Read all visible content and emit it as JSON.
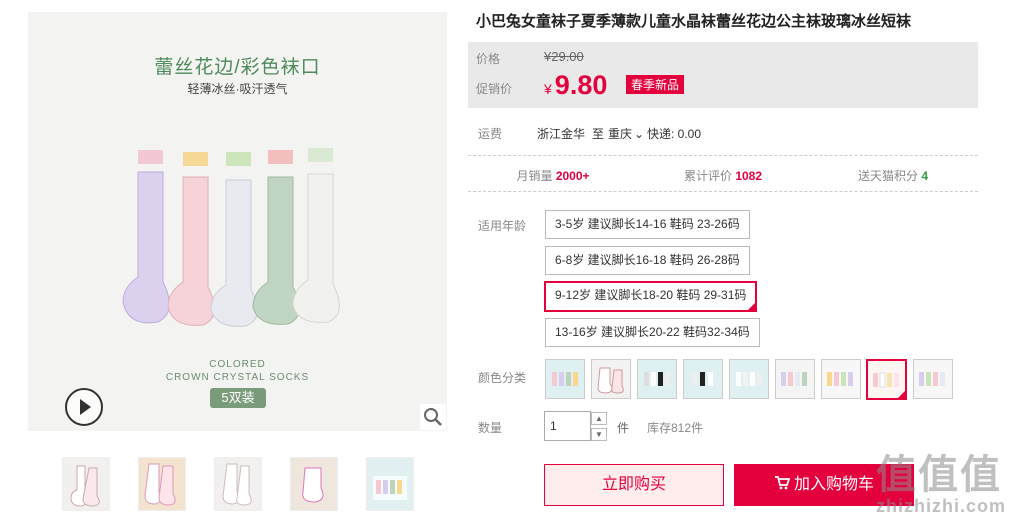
{
  "product": {
    "title": "小巴兔女童袜子夏季薄款儿童水晶袜蕾丝花边公主袜玻璃冰丝短袜",
    "image": {
      "headline": "蕾丝花边/彩色袜口",
      "subline": "轻薄冰丝·吸汗透气",
      "en_line1": "COLORED",
      "en_line2": "CROWN CRYSTAL SOCKS",
      "pack_badge": "5双装",
      "play_icon": "play-icon",
      "zoom_icon": "zoom-icon"
    }
  },
  "price": {
    "orig_label": "价格",
    "orig_value": "¥29.00",
    "promo_label": "促销价",
    "currency": "¥",
    "promo_value": "9.80",
    "promo_tag": "春季新品"
  },
  "shipping": {
    "label": "运费",
    "from": "浙江金华",
    "to_prefix": "至",
    "to": "重庆",
    "express": "快递: 0.00"
  },
  "stats": {
    "monthly_label": "月销量",
    "monthly_value": "2000+",
    "reviews_label": "累计评价",
    "reviews_value": "1082",
    "points_label": "送天猫积分",
    "points_value": "4"
  },
  "age": {
    "label": "适用年龄",
    "options": [
      "3-5岁 建议脚长14-16 鞋码 23-26码",
      "6-8岁 建议脚长16-18 鞋码 26-28码",
      "9-12岁 建议脚长18-20 鞋码 29-31码",
      "13-16岁 建议脚长20-22 鞋码32-34码"
    ]
  },
  "color": {
    "label": "颜色分类"
  },
  "quantity": {
    "label": "数量",
    "value": "1",
    "unit": "件",
    "stock": "库存812件"
  },
  "actions": {
    "buy_now": "立即购买",
    "add_to_cart": "加入购物车"
  },
  "watermark": {
    "cn": "值值值",
    "en": "zhizhizhi.com"
  },
  "colors": {
    "accent": "#e4003d"
  }
}
